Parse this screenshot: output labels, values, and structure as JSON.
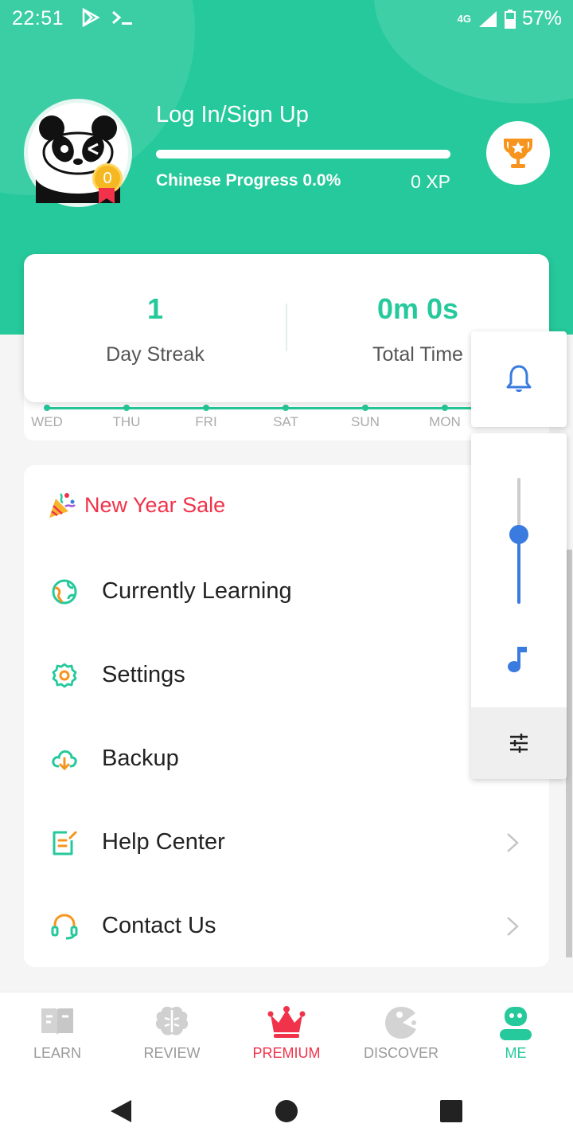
{
  "status_bar": {
    "time": "22:51",
    "network": "4G",
    "battery": "57%"
  },
  "profile": {
    "login_label": "Log In/Sign Up",
    "progress_label": "Chinese Progress 0.0%",
    "progress_fraction": 0.0,
    "xp_label": "0 XP",
    "level": "0"
  },
  "stats": {
    "streak_value": "1",
    "streak_label": "Day Streak",
    "time_value": "0m 0s",
    "time_label": "Total Time",
    "days": [
      "WED",
      "THU",
      "FRI",
      "SAT",
      "SUN",
      "MON"
    ]
  },
  "menu": {
    "sale_label": "New Year Sale",
    "items": [
      {
        "label": "Currently Learning",
        "icon": "globe-icon"
      },
      {
        "label": "Settings",
        "icon": "gear-icon"
      },
      {
        "label": "Backup",
        "icon": "cloud-download-icon"
      },
      {
        "label": "Help Center",
        "icon": "help-doc-icon"
      },
      {
        "label": "Contact Us",
        "icon": "headset-icon"
      }
    ]
  },
  "volume_panel": {
    "level_fraction": 0.55
  },
  "bottom_nav": {
    "learn": "LEARN",
    "review": "REVIEW",
    "premium": "PREMIUM",
    "discover": "DISCOVER",
    "me": "ME"
  },
  "colors": {
    "brand": "#25c99b",
    "sale": "#f0334a",
    "volume_accent": "#3a7be0"
  }
}
